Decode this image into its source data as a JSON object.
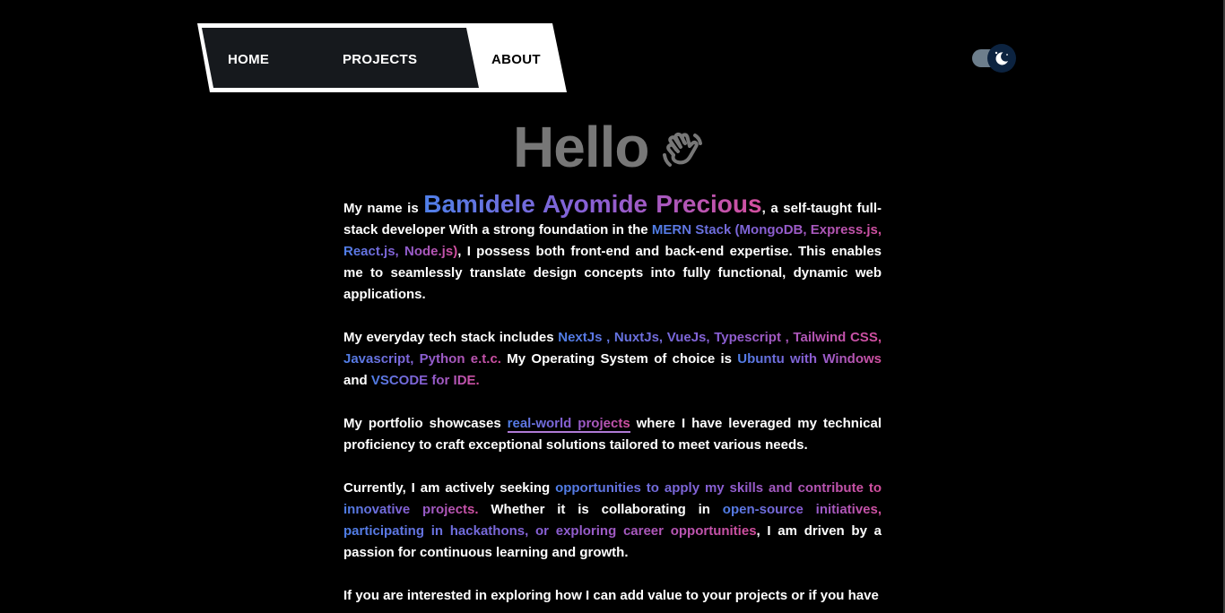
{
  "nav": {
    "items": [
      {
        "label": "HOME"
      },
      {
        "label": "PROJECTS"
      },
      {
        "label": "ABOUT"
      }
    ]
  },
  "theme_toggle": {
    "state": "dark",
    "icon": "moon-icon",
    "track_color": "#6d7e8c",
    "knob_color": "#0c2340"
  },
  "heading": {
    "title": "Hello",
    "icon": "waving-hand-icon"
  },
  "about": {
    "p1": {
      "t1": "My name is ",
      "name": "Bamidele Ayomide Precious",
      "t2": ", a self-taught full-stack developer With a strong foundation in the ",
      "stack": "MERN Stack (MongoDB, Express.js, React.js, Node.js)",
      "t3": ", I possess both front-end and back-end expertise. This enables me to seamlessly translate design concepts into fully functional, dynamic web applications."
    },
    "p2": {
      "t1": "My everyday tech stack includes ",
      "tech": "NextJs , NuxtJs, VueJs, Typescript , Tailwind CSS, Javascript, Python e.t.c.",
      "t2": " My Operating System of choice is ",
      "os": "Ubuntu with Windows",
      "t3": " and ",
      "ide": "VSCODE for IDE."
    },
    "p3": {
      "t1": "My portfolio showcases ",
      "link": "real-world projects",
      "t2": " where I have leveraged my technical proficiency to craft exceptional solutions tailored to meet various needs."
    },
    "p4": {
      "t1": "Currently, I am actively seeking ",
      "h1": "opportunities to apply my skills and contribute to innovative projects.",
      "t2": " Whether it is collaborating in ",
      "h2": "open-source initiatives, participating in hackathons, or exploring career opportunities",
      "t3": ", I am driven by a passion for continuous learning and growth."
    },
    "p5": {
      "t1": "If you are interested in exploring how I can add value to your projects or if you have"
    }
  },
  "colors": {
    "background": "#000000",
    "heading": "#777777",
    "text": "#ffffff",
    "gradient_start": "#4f7fe8",
    "gradient_mid": "#8a5fd4",
    "gradient_end": "#d44f9e"
  }
}
